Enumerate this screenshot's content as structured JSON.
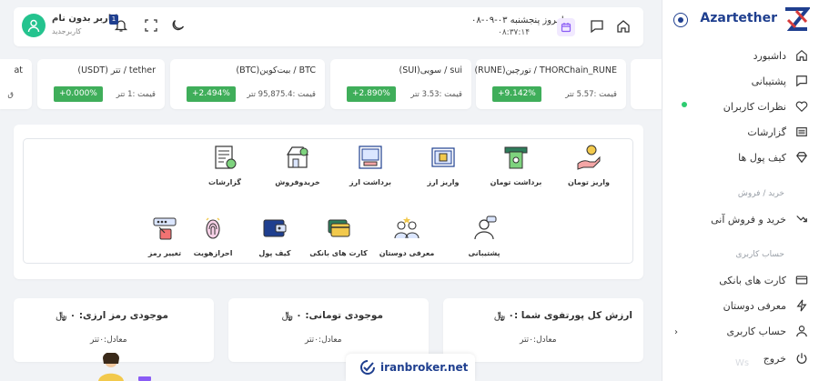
{
  "brand": {
    "name": "Azartether"
  },
  "header": {
    "user_name": "کاربر بدون نام",
    "user_role": "کاربرجدید",
    "notification_count": "1",
    "date": "امروز پنجشنبه ۰۳-۰۹-۰۸",
    "time": "۰۸:۳۷:۱۴"
  },
  "sidebar": {
    "items": [
      {
        "label": "داشبورد",
        "icon": "home-icon"
      },
      {
        "label": "پشتیبانی",
        "icon": "chat-icon"
      },
      {
        "label": "نظرات کاربران",
        "icon": "heart-icon"
      },
      {
        "label": "گزارشات",
        "icon": "list-icon"
      },
      {
        "label": "کیف پول ها",
        "icon": "diamond-icon"
      }
    ],
    "section_trade": "خرید / فروش",
    "trade_item": {
      "label": "خرید و فروش آنی",
      "icon": "trend-icon"
    },
    "section_account": "حساب کاربری",
    "account_items": [
      {
        "label": "کارت های بانکی",
        "icon": "card-icon"
      },
      {
        "label": "معرفی دوستان",
        "icon": "bolt-icon"
      },
      {
        "label": "حساب کاربری",
        "icon": "user-icon"
      },
      {
        "label": "خروج",
        "icon": "power-icon"
      }
    ]
  },
  "tickers": [
    {
      "name": "THORChain_RUNE / تورچین(RUNE)",
      "price": "قیمت :5.57 تتر",
      "change": "+9.142%"
    },
    {
      "name": "sui / سویی(SUI)",
      "price": "قیمت :3.53 تتر",
      "change": "+2.890%"
    },
    {
      "name": "BTC / بیت‌کوین(BTC)",
      "price": "قیمت :95,875.4 تتر",
      "change": "+2.494%"
    },
    {
      "name": "tether / تتر (USDT)",
      "price": "قیمت :1 تتر",
      "change": "+0.000%"
    },
    {
      "name": "at",
      "price": "ق",
      "change": ""
    }
  ],
  "services": {
    "row1": [
      {
        "label": "واریز تومان",
        "icon": "hand-coin-icon"
      },
      {
        "label": "برداشت تومان",
        "icon": "cash-withdraw-icon"
      },
      {
        "label": "واریز ارز",
        "icon": "crypto-deposit-icon"
      },
      {
        "label": "برداشت ارز",
        "icon": "crypto-withdraw-icon"
      },
      {
        "label": "خریدوفروش",
        "icon": "shop-icon"
      },
      {
        "label": "گزارشات",
        "icon": "report-icon"
      }
    ],
    "row2": [
      {
        "label": "پشتیبانی",
        "icon": "support-icon"
      },
      {
        "label": "معرفی دوستان",
        "icon": "referral-icon"
      },
      {
        "label": "کارت های بانکی",
        "icon": "bank-cards-icon"
      },
      {
        "label": "کیف پول",
        "icon": "wallet-icon"
      },
      {
        "label": "احرازهویت",
        "icon": "fingerprint-icon"
      },
      {
        "label": "تغییر رمز",
        "icon": "password-icon"
      }
    ]
  },
  "balances": [
    {
      "title": "ارزش کل پورتفوی شما :۰ ﷼",
      "equiv": "معادل:۰تتر"
    },
    {
      "title": "موجودی تومانی: ۰ ﷼",
      "equiv": "معادل:۰تتر"
    },
    {
      "title": "موجودی رمز ارزی: ۰ ﷼",
      "equiv": "معادل:۰تتر"
    }
  ],
  "watermark": {
    "text": "iranbroker.net",
    "faint": "Ws"
  },
  "colors": {
    "brand_blue": "#1f3f8f",
    "positive_green": "#3fae5a",
    "avatar_green": "#24c38e",
    "online_dot": "#2ecc71"
  }
}
